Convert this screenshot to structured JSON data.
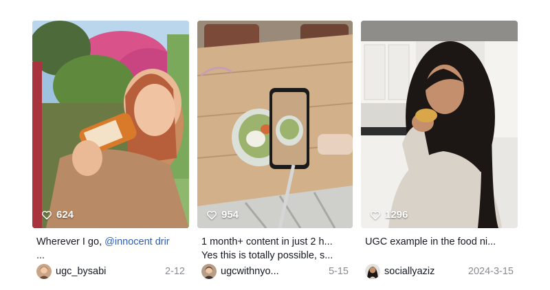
{
  "videos": [
    {
      "likes": "624",
      "caption_line1_prefix": "Wherever I go, ",
      "caption_mention": "@innocent drir",
      "caption_line2": "...",
      "username": "ugc_bysabi",
      "date": "2-12"
    },
    {
      "likes": "954",
      "caption_line1": "1 month+ content in just 2 h...",
      "caption_line2": "Yes this is totally possible, s...",
      "username": "ugcwithnyo...",
      "date": "5-15"
    },
    {
      "likes": "1296",
      "caption_line1": "UGC example in the food ni...",
      "username": "sociallyaziz",
      "date": "2024-3-15"
    }
  ],
  "colors": {
    "text": "#161823",
    "mention": "#2b5db9",
    "date": "#8a8b91"
  },
  "icons": {
    "likes": "heart-outline-icon"
  }
}
